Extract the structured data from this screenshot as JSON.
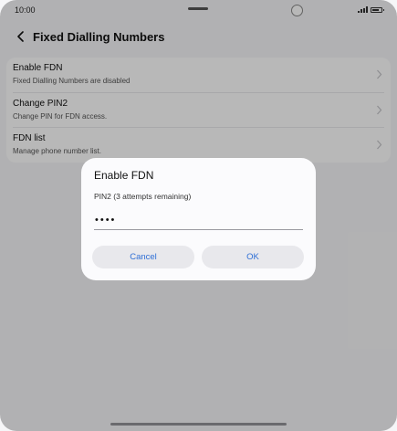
{
  "status_bar": {
    "time": "10:00"
  },
  "header": {
    "title": "Fixed Dialling Numbers"
  },
  "settings": [
    {
      "label": "Enable FDN",
      "sub": "Fixed Dialling Numbers are disabled"
    },
    {
      "label": "Change PIN2",
      "sub": "Change PIN for FDN access."
    },
    {
      "label": "FDN list",
      "sub": "Manage phone number list."
    }
  ],
  "dialog": {
    "title": "Enable FDN",
    "prompt": "PIN2 (3 attempts remaining)",
    "input_value": "••••",
    "cancel_label": "Cancel",
    "ok_label": "OK"
  },
  "colors": {
    "accent": "#2f6fd6",
    "scrim": "rgba(0,0,0,0.28)"
  }
}
